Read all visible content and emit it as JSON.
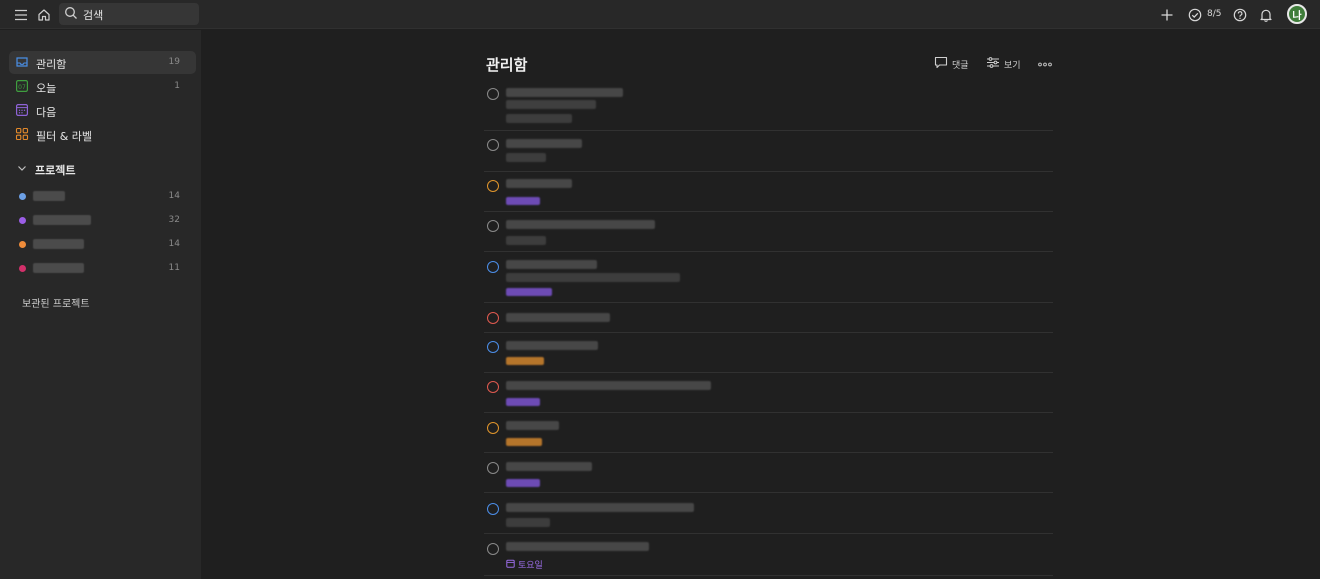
{
  "topbar": {
    "search_label": "검색",
    "karma": "8/5",
    "avatar_initial": "나"
  },
  "sidebar": {
    "nav": [
      {
        "label": "관리함",
        "count": "19",
        "icon": "inbox-icon",
        "color": "#4a8fe7",
        "active": true
      },
      {
        "label": "오늘",
        "count": "1",
        "icon": "calendar-today-icon",
        "color": "#3f9e3f",
        "day": "07"
      },
      {
        "label": "다음",
        "count": "",
        "icon": "calendar-upcoming-icon",
        "color": "#8e63d6"
      },
      {
        "label": "필터 & 라벨",
        "count": "",
        "icon": "filters-icon",
        "color": "#e48a2b"
      }
    ],
    "projects_label": "프로젝트",
    "projects": [
      {
        "color": "#6ca0e6",
        "count": "14"
      },
      {
        "color": "#9b5ee6",
        "count": "32"
      },
      {
        "color": "#f08c3a",
        "count": "14"
      },
      {
        "color": "#d2306a",
        "count": "11"
      }
    ],
    "archived_label": "보관된 프로젝트"
  },
  "main": {
    "title": "관리함",
    "comment_label": "댓글",
    "view_label": "보기",
    "last_task_tag": "토요일"
  },
  "colors": {
    "priority_gray": "#8a8a8a",
    "priority_orange": "#e0952c",
    "priority_blue": "#4c8ee8",
    "priority_red": "#e05a50",
    "tag_purple": "#6d4bb5",
    "tag_orange": "#b5752b"
  }
}
